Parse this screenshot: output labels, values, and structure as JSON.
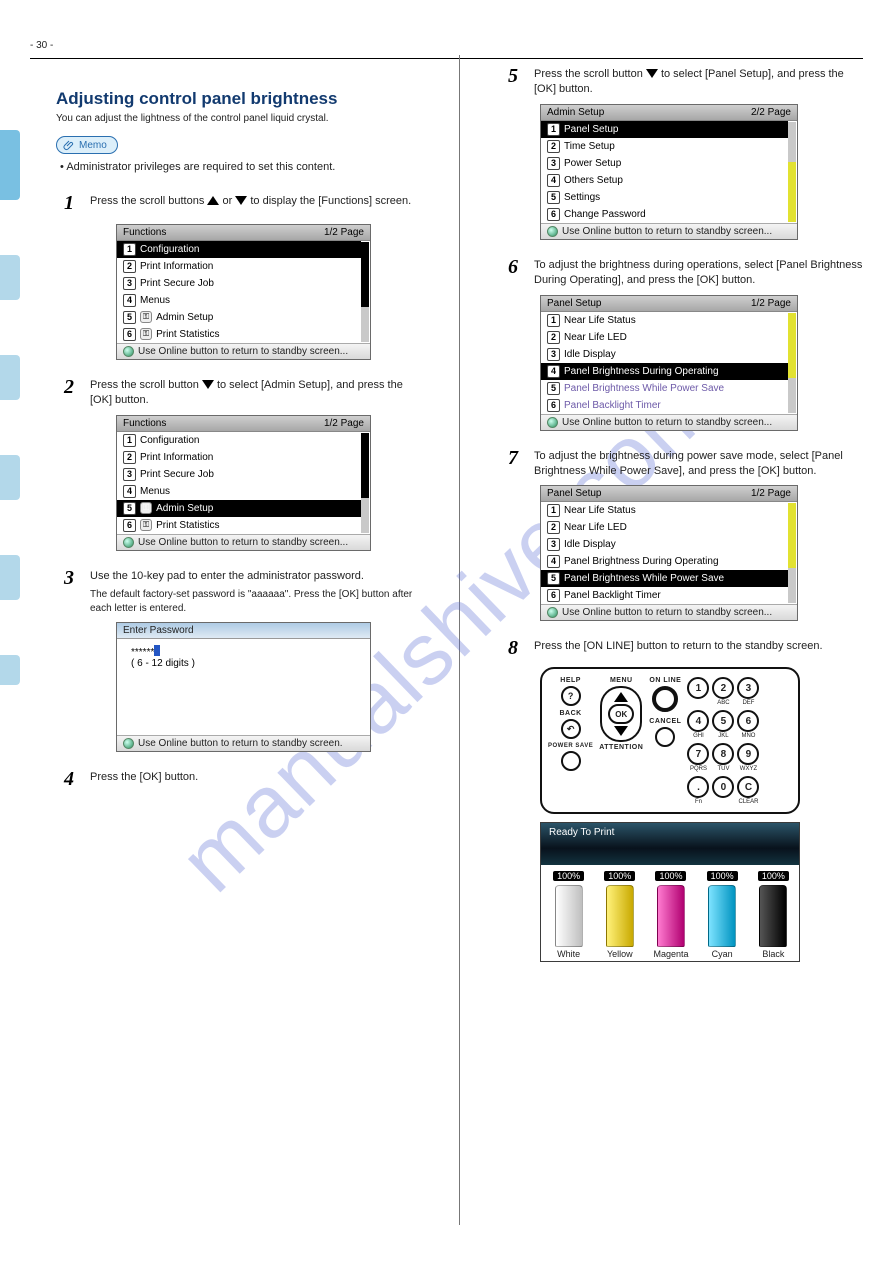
{
  "page_number": "- 30 -",
  "watermark": "manualshive.com",
  "heading": "Adjusting control panel brightness",
  "subheading": "Adjusting control panel brightness",
  "memo_label": "Memo",
  "memo_text": "Administrator privileges are required to set this content.",
  "steps": [
    {
      "n": "1",
      "text_a": "Press the scroll buttons ",
      "text_b": " or ",
      "text_c": " to display the [Functions] screen."
    },
    {
      "n": "2",
      "text_a": "Press the scroll button ",
      "text_b": " to select [Admin Setup], and press the [OK] button."
    },
    {
      "n": "3",
      "text_a": "Use the 10-key pad to enter the administrator password.",
      "note": "The default factory-set password is \"aaaaaa\". Press the [OK] button after each letter is entered."
    },
    {
      "n": "4",
      "text_a": "Press the [OK] button."
    },
    {
      "n": "5",
      "text_a": "Press the scroll button ",
      "text_b": " to select [Panel Setup], and press the [OK] button."
    },
    {
      "n": "6",
      "text_a": "To adjust the brightness during operations, select [Panel Brightness During Operating], and press the [OK] button."
    },
    {
      "n": "7",
      "text_a": "To adjust the brightness during power save mode, select [Panel Brightness While Power Save], and press the [OK] button."
    },
    {
      "n": "8",
      "text_a": "Press the [ON LINE] button to return to the standby screen."
    }
  ],
  "lcd_functions": {
    "title": "Functions",
    "page": "1/2 Page",
    "items": [
      "Configuration",
      "Print Information",
      "Print Secure Job",
      "Menus",
      "Admin Setup",
      "Print Statistics"
    ],
    "key_items": [
      4,
      5
    ],
    "hint": "Use Online button to return to standby screen..."
  },
  "lcd_password": {
    "title": "Enter Password",
    "masked": "******",
    "range": "( 6 - 12 digits )",
    "hint": "Use Online button to return to standby screen."
  },
  "lcd_admin": {
    "title": "Admin Setup",
    "page": "2/2 Page",
    "items": [
      "Panel Setup",
      "Time Setup",
      "Power Setup",
      "Others Setup",
      "Settings",
      "Change Password"
    ],
    "hint": "Use Online button to return to standby screen..."
  },
  "lcd_panel6": {
    "title": "Panel Setup",
    "page": "1/2 Page",
    "items": [
      "Near Life Status",
      "Near Life LED",
      "Idle Display",
      "Panel Brightness During Operating",
      "Panel Brightness While Power Save",
      "Panel Backlight Timer"
    ],
    "hint": "Use Online button to return to standby screen..."
  },
  "lcd_panel7": {
    "title": "Panel Setup",
    "page": "1/2 Page",
    "items": [
      "Near Life Status",
      "Near Life LED",
      "Idle Display",
      "Panel Brightness During Operating",
      "Panel Brightness While Power Save",
      "Panel Backlight Timer"
    ],
    "hint": "Use Online button to return to standby screen..."
  },
  "ctrl": {
    "help": "HELP",
    "menu": "MENU",
    "online": "ON LINE",
    "back": "BACK",
    "ok": "OK",
    "cancel": "CANCEL",
    "powersave": "POWER SAVE",
    "attention": "ATTENTION",
    "fn": "Fn",
    "clear": "CLEAR",
    "keys": [
      "1",
      "2",
      "3",
      "4",
      "5",
      "6",
      "7",
      "8",
      "9",
      ".",
      "0",
      "C"
    ],
    "subs": [
      "",
      "ABC",
      "DEF",
      "GHI",
      "JKL",
      "MNO",
      "PQRS",
      "TUV",
      "WXYZ",
      "",
      "",
      ""
    ]
  },
  "ready": {
    "title": "Ready To Print",
    "pct": "100%",
    "labels": [
      "White",
      "Yellow",
      "Magenta",
      "Cyan",
      "Black"
    ]
  }
}
